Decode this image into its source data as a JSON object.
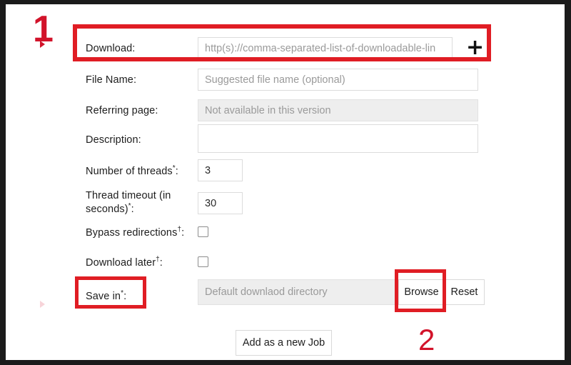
{
  "form": {
    "fields": [
      {
        "label": "Download:",
        "required_mark": "",
        "placeholder": "http(s)://comma-separated-list-of-downloadable-lin",
        "value": "",
        "state": "enabled",
        "type": "text"
      },
      {
        "label": "File Name:",
        "required_mark": "",
        "placeholder": "Suggested file name (optional)",
        "value": "",
        "state": "enabled",
        "type": "text"
      },
      {
        "label": "Referring page:",
        "required_mark": "",
        "placeholder": "Not available in this version",
        "value": "",
        "state": "disabled",
        "type": "text"
      },
      {
        "label": "Description:",
        "required_mark": "",
        "placeholder": "",
        "value": "",
        "state": "enabled",
        "type": "text"
      },
      {
        "label": "Number of threads",
        "required_mark": "*",
        "label_suffix": ":",
        "placeholder": "",
        "value": "3",
        "state": "enabled",
        "type": "number"
      },
      {
        "label": "Thread timeout (in seconds)",
        "required_mark": "*",
        "label_suffix": ":",
        "placeholder": "",
        "value": "30",
        "state": "enabled",
        "type": "number"
      },
      {
        "label": "Bypass redirections",
        "required_mark": "†",
        "label_suffix": ":",
        "checked": false,
        "type": "checkbox"
      },
      {
        "label": "Download later",
        "required_mark": "†",
        "label_suffix": ":",
        "checked": false,
        "type": "checkbox"
      },
      {
        "label": "Save in",
        "required_mark": "*",
        "label_suffix": ":",
        "placeholder": "Default downlaod directory",
        "value": "",
        "state": "disabled",
        "type": "path"
      }
    ],
    "labels": {
      "download": "Download:",
      "file_name": "File Name:",
      "referring_page": "Referring page:",
      "description": "Description:",
      "number_of_threads": "Number of threads",
      "thread_timeout": "Thread timeout (in seconds)",
      "bypass_redirections": "Bypass redirections",
      "download_later": "Download later",
      "save_in": "Save in"
    },
    "marks": {
      "asterisk": "*",
      "dagger": "†",
      "colon": ":"
    },
    "placeholders": {
      "download": "http(s)://comma-separated-list-of-downloadable-lin",
      "file_name": "Suggested file name (optional)",
      "referring_page": "Not available in this version",
      "description": "",
      "save_in": "Default downlaod directory"
    },
    "values": {
      "number_of_threads": "3",
      "thread_timeout": "30"
    },
    "buttons": {
      "add_link": "+",
      "browse": "Browse",
      "reset": "Reset",
      "submit": "Add as a new Job"
    }
  },
  "annotations": {
    "markers": [
      {
        "id": "1",
        "text": "1"
      },
      {
        "id": "2",
        "text": "2"
      }
    ],
    "highlight_color": "#e01d24",
    "marker_color": "#d2132a",
    "highlighted_targets": [
      "download-row",
      "save-in-label",
      "browse-button"
    ]
  },
  "theme": {
    "page_background": "#ffffff",
    "frame": "#1b1b1b",
    "label_text": "#1d1d1d",
    "placeholder_text": "#9a9a9a",
    "field_border": "#dcdcdc",
    "disabled_field_background": "#eeeeee",
    "accent_red": "#e01d24"
  }
}
